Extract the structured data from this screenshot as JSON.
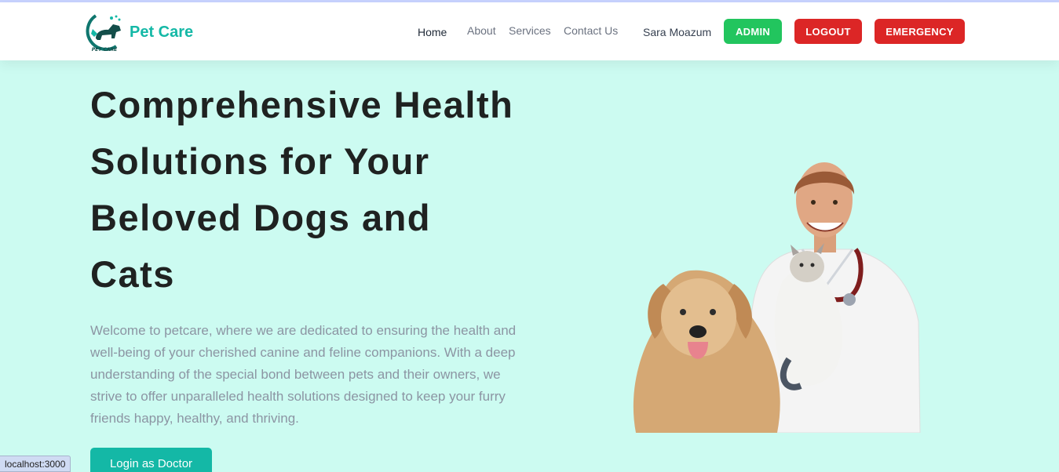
{
  "brand": {
    "name": "Pet Care",
    "logo_text": "PET CARE"
  },
  "nav": {
    "home": "Home",
    "about": "About",
    "services": "Services",
    "contact": "Contact Us"
  },
  "user": {
    "name": "Sara Moazum"
  },
  "buttons": {
    "admin": "ADMIN",
    "logout": "LOGOUT",
    "emergency": "EMERGENCY"
  },
  "hero": {
    "title_lines": [
      "Comprehensive Health",
      "Solutions for Your",
      "Beloved Dogs and",
      "Cats"
    ],
    "description": "Welcome to petcare, where we are dedicated to ensuring the health and well-being of your cherished canine and feline companions. With a deep understanding of the special bond between pets and their owners, we strive to offer unparalleled health solutions designed to keep your furry friends happy, healthy, and thriving.",
    "cta": "Login as Doctor"
  },
  "status_bar": {
    "url": "localhost:3000"
  },
  "colors": {
    "teal": "#14b8a6",
    "green": "#22c55e",
    "red": "#dc2626",
    "hero_bg": "#ccfbf1"
  }
}
